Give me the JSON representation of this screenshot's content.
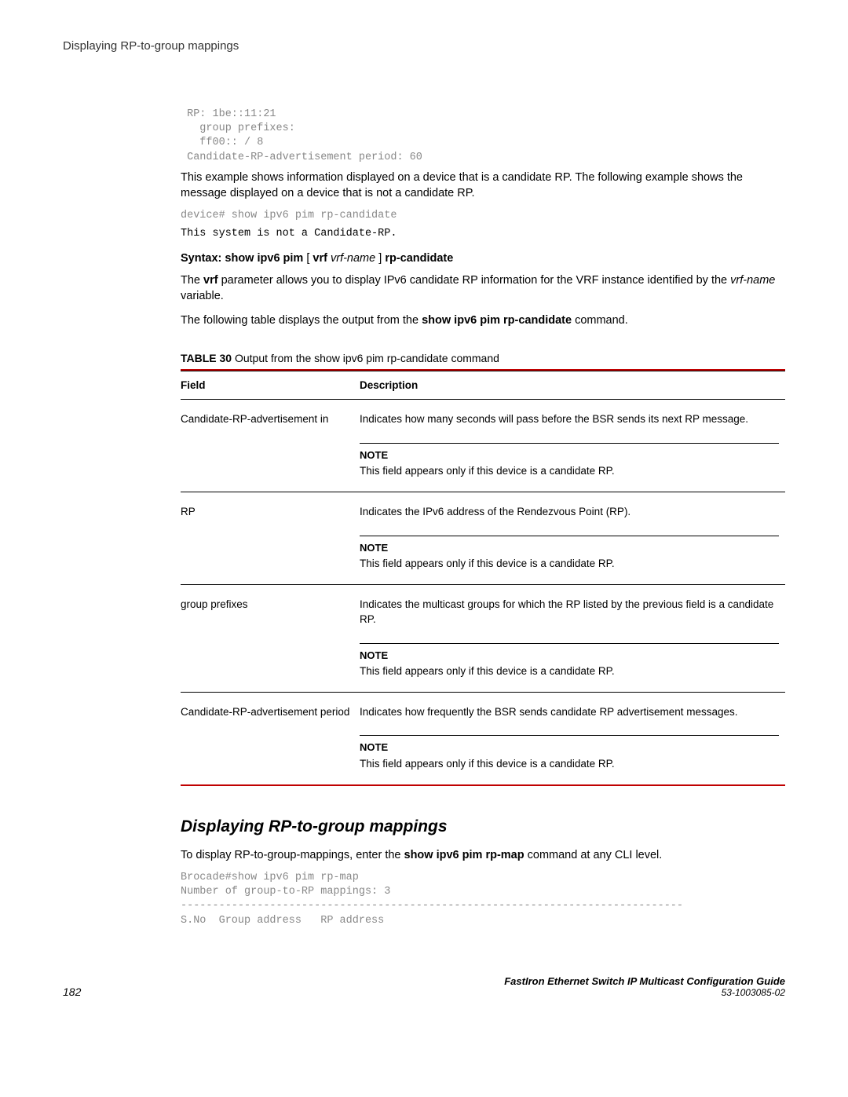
{
  "header": {
    "title": "Displaying RP-to-group mappings"
  },
  "code": {
    "block1": " RP: 1be::11:21\n   group prefixes:\n   ff00:: / 8\n Candidate-RP-advertisement period: 60",
    "block2": "device# show ipv6 pim rp-candidate",
    "block3": "This system is not a Candidate-RP.",
    "block4": "Brocade#show ipv6 pim rp-map\nNumber of group-to-RP mappings: 3\n-------------------------------------------------------------------------------\nS.No  Group address   RP address"
  },
  "para": {
    "intro1": "This example shows information displayed on a device that is a candidate RP. The following example shows the message displayed on a device that is not a candidate RP.",
    "vrf_pre": "The ",
    "vrf_bold": "vrf",
    "vrf_post": " parameter allows you to display IPv6 candidate RP information for the VRF instance identified by the ",
    "vrf_ital": "vrf-name",
    "vrf_end": " variable.",
    "following_pre": "The following table displays the output from the ",
    "following_cmd": "show ipv6 pim rp-candidate",
    "following_post": " command.",
    "section2_pre": "To display RP-to-group-mappings, enter the ",
    "section2_cmd": "show ipv6 pim rp-map",
    "section2_post": " command at any CLI level."
  },
  "syntax": {
    "label": "Syntax: show ipv6 pim",
    "lbracket": " [ ",
    "vrf": "vrf",
    "vrfname": " vrf-name",
    "rbracket": " ] ",
    "tail": "rp-candidate"
  },
  "table": {
    "caption_label": "TABLE 30",
    "caption_text": "   Output from the show ipv6 pim rp-candidate command",
    "head_field": "Field",
    "head_desc": "Description",
    "rows": [
      {
        "field": "Candidate-RP-advertisement in",
        "desc": "Indicates how many seconds will pass before the BSR sends its next RP message."
      },
      {
        "field": "RP",
        "desc": "Indicates the IPv6 address of the Rendezvous Point (RP)."
      },
      {
        "field": "group prefixes",
        "desc": "Indicates the multicast groups for which the RP listed by the previous field is a candidate RP."
      },
      {
        "field": "Candidate-RP-advertisement period",
        "desc": "Indicates how frequently the BSR sends candidate RP advertisement messages."
      }
    ],
    "note_label": "NOTE",
    "note_text": "This field appears only if this device is a candidate RP."
  },
  "section2_heading": "Displaying RP-to-group mappings",
  "footer": {
    "page": "182",
    "title": "FastIron Ethernet Switch IP Multicast Configuration Guide",
    "docnum": "53-1003085-02"
  }
}
